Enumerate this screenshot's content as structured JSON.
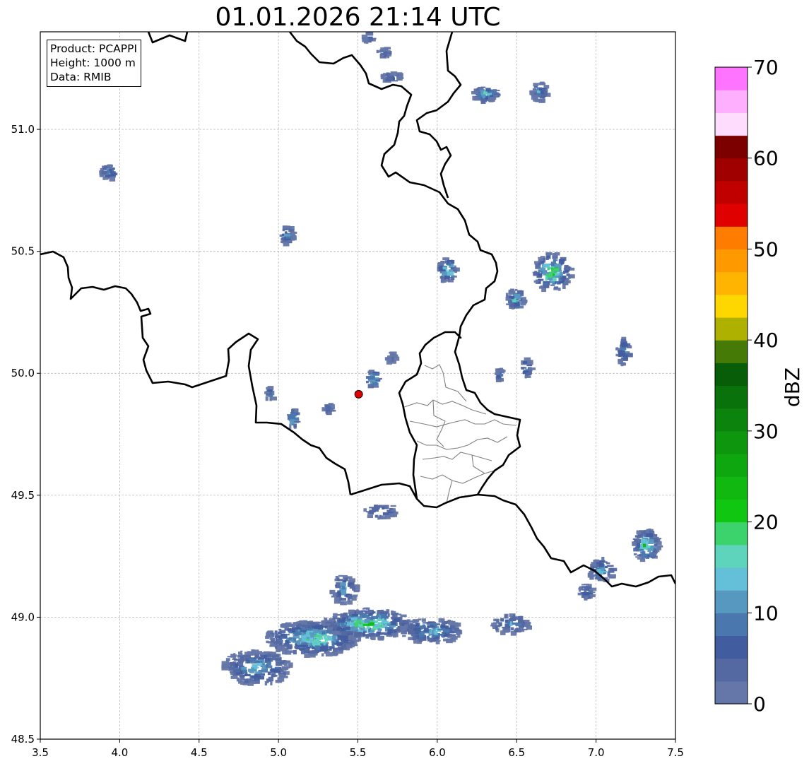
{
  "title": "01.01.2026 21:14 UTC",
  "info_box": {
    "product": "Product: PCAPPI",
    "height": "Height: 1000 m",
    "data": "Data: RMIB"
  },
  "axes": {
    "x_ticks": [
      "3.5",
      "4.0",
      "4.5",
      "5.0",
      "5.5",
      "6.0",
      "6.5",
      "7.0",
      "7.5"
    ],
    "y_ticks": [
      "48.5",
      "49.0",
      "49.5",
      "50.0",
      "50.5",
      "51.0"
    ],
    "x_range": [
      3.5,
      7.5
    ],
    "y_range": [
      48.5,
      51.4
    ],
    "grid": true
  },
  "radar_site": {
    "lon": 5.505,
    "lat": 49.914,
    "color": "#e00000"
  },
  "colorbar": {
    "label": "dBZ",
    "tick_labels": [
      "0",
      "10",
      "20",
      "30",
      "40",
      "50",
      "60",
      "70"
    ],
    "range": [
      0,
      70
    ],
    "step": 2.5,
    "colors": [
      "#6577a8",
      "#5468a2",
      "#425d9f",
      "#4a78ae",
      "#5798c0",
      "#63c0d8",
      "#5fd4bc",
      "#3cd36c",
      "#11c611",
      "#10b810",
      "#0fa70f",
      "#0e960e",
      "#0c830c",
      "#0a720a",
      "#085e08",
      "#457a07",
      "#aeb100",
      "#fed600",
      "#feb400",
      "#fe9a00",
      "#fe7c00",
      "#e00000",
      "#c00000",
      "#a00000",
      "#7c0000",
      "#fedcfe",
      "#feb0fe",
      "#fe74fe",
      "#ef32ef"
    ]
  },
  "colors": {
    "borders": "#000000",
    "districts": "#808080",
    "grid": "#b0b0b0"
  }
}
